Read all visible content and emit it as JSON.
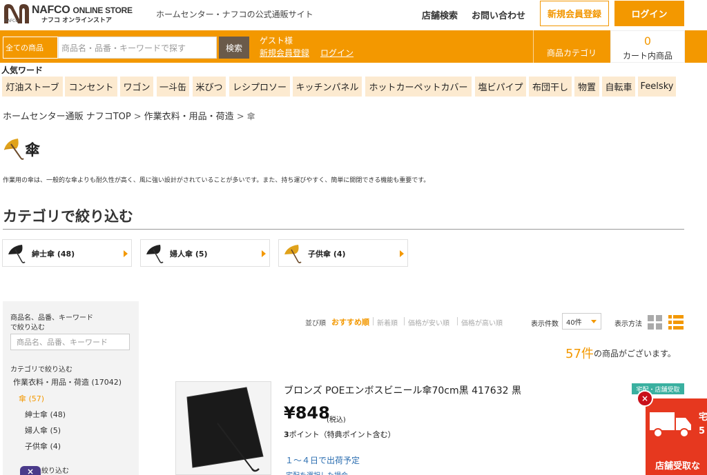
{
  "header": {
    "logo_main": "NAFCO",
    "logo_store": "ONLINE STORE",
    "logo_kana": "ナフコ オンラインストア",
    "logo_small": "NAFCO",
    "tagline": "ホームセンター・ナフコの公式通販サイト",
    "store_search": "店舗検索",
    "contact": "お問い合わせ",
    "register": "新規会員登録",
    "login": "ログイン"
  },
  "searchbar": {
    "category_select": "全ての商品",
    "placeholder": "商品名・品番・キーワードで探す",
    "button": "検索",
    "guest": "ゲスト様",
    "register_link": "新規会員登録",
    "login_link": "ログイン",
    "product_category": "商品カテゴリ",
    "cart_count": "0",
    "cart_label": "カート内商品"
  },
  "popular": {
    "title": "人気ワード",
    "tags": [
      "灯油ストーブ",
      "コンセント",
      "ワゴン",
      "一斗缶",
      "米びつ",
      "レシプロソー",
      "キッチンパネル",
      "ホットカーペットカバー",
      "塩ビパイプ",
      "布団干し",
      "物置",
      "自転車",
      "Feelsky"
    ]
  },
  "breadcrumb": {
    "items": [
      "ホームセンター通販 ナフコTOP",
      "作業衣料・用品・荷造",
      "傘"
    ],
    "sep": ">"
  },
  "page": {
    "title": "傘",
    "description": "作業用の傘は、一般的な傘よりも耐久性が高く、風に強い設計がされていることが多いです。また、持ち運びやすく、簡単に開閉できる機能も重要です。",
    "filter_title": "カテゴリで絞り込む"
  },
  "categories": [
    {
      "label": "紳士傘 (48)",
      "icon": "umbrella-black-icon",
      "color": "#222222"
    },
    {
      "label": "婦人傘 (5)",
      "icon": "umbrella-black-icon",
      "color": "#222222"
    },
    {
      "label": "子供傘 (4)",
      "icon": "umbrella-yellow-icon",
      "color": "#e0a21a"
    }
  ],
  "sidebar": {
    "keyword_label_1": "商品名、品番、キーワード",
    "keyword_label_2": "で絞り込む",
    "keyword_placeholder": "商品名、品番、キーワード",
    "category_label": "カテゴリで絞り込む",
    "parent": "作業衣料・用品・荷造 (17042)",
    "current": "傘 (57)",
    "children": [
      "紳士傘 (48)",
      "婦人傘 (5)",
      "子供傘 (4)"
    ],
    "next_label_partial": "絞り込む"
  },
  "sort": {
    "label": "並び順",
    "active": "おすすめ順",
    "options": [
      "新着順",
      "価格が安い順",
      "価格が高い順"
    ],
    "per_page_label": "表示件数",
    "per_page_value": "40件",
    "view_label": "表示方法"
  },
  "results": {
    "count": "57件",
    "text": "の商品がございます。"
  },
  "product": {
    "name": "ブロンズ POEエンボスビニール傘70cm黒 417632 黒",
    "price": "¥848",
    "tax": "(税込)",
    "points_num": "3",
    "points_text": "ポイント（特典ポイント含む）",
    "shipping": "１～４日で出荷予定",
    "shipping_sub": "宅配を選択した場合",
    "badge": "宅配・店舗受取"
  },
  "float_banner": {
    "text1": "宅",
    "text2": "5",
    "text3": "店舗受取な",
    "close": "×"
  },
  "bottom_close": "×",
  "colors": {
    "accent": "#f39800",
    "tag_bg": "#fcead0",
    "banner_red": "#e6381f",
    "badge_teal": "#3ab0a0",
    "link_blue": "#2a6db0"
  }
}
